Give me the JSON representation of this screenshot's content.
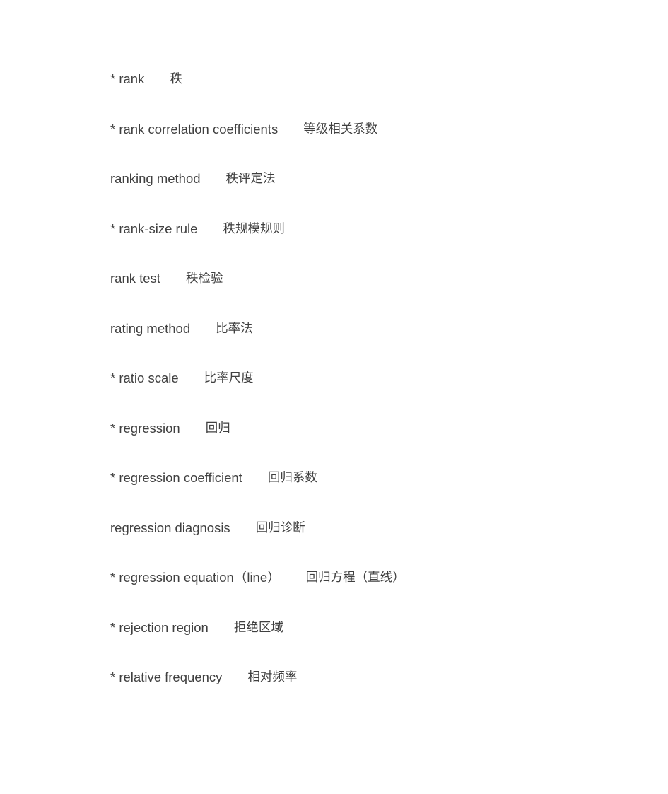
{
  "document": {
    "entries": [
      {
        "term": "* rank",
        "translation": "秩"
      },
      {
        "term": "* rank correlation coefficients",
        "translation": "等级相关系数"
      },
      {
        "term": "ranking method",
        "translation": "秩评定法"
      },
      {
        "term": "* rank-size rule",
        "translation": "秩规模规则"
      },
      {
        "term": "rank test",
        "translation": "秩检验"
      },
      {
        "term": "rating method",
        "translation": "比率法"
      },
      {
        "term": "* ratio scale",
        "translation": "比率尺度"
      },
      {
        "term": "* regression",
        "translation": "回归"
      },
      {
        "term": "* regression coefficient",
        "translation": "回归系数"
      },
      {
        "term": "regression diagnosis",
        "translation": "回归诊断"
      },
      {
        "term": "* regression equation（line）",
        "translation": "回归方程（直线）"
      },
      {
        "term": "* rejection region",
        "translation": "拒绝区域"
      },
      {
        "term": "* relative frequency",
        "translation": "相对频率"
      }
    ]
  }
}
